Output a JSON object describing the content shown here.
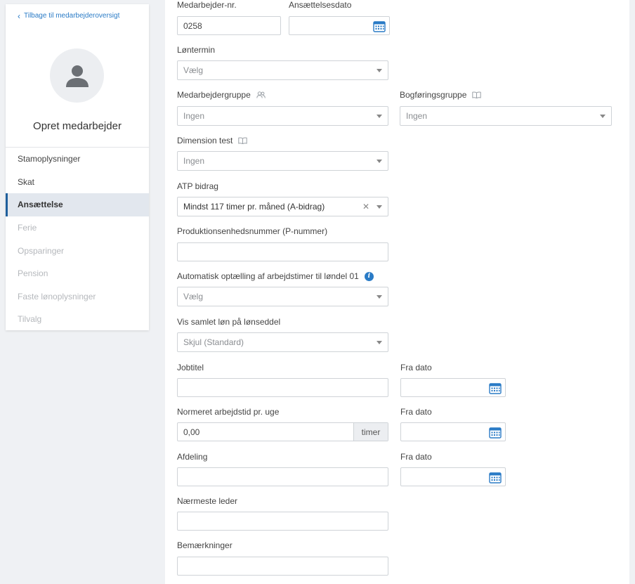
{
  "sidebar": {
    "back_label": "Tilbage til medarbejderoversigt",
    "title": "Opret medarbejder",
    "items": [
      {
        "label": "Stamoplysninger",
        "state": "normal"
      },
      {
        "label": "Skat",
        "state": "normal"
      },
      {
        "label": "Ansættelse",
        "state": "active"
      },
      {
        "label": "Ferie",
        "state": "disabled"
      },
      {
        "label": "Opsparinger",
        "state": "disabled"
      },
      {
        "label": "Pension",
        "state": "disabled"
      },
      {
        "label": "Faste lønoplysninger",
        "state": "disabled"
      },
      {
        "label": "Tilvalg",
        "state": "disabled"
      }
    ]
  },
  "form": {
    "employee_no": {
      "label": "Medarbejder-nr.",
      "value": "0258"
    },
    "employment_date": {
      "label": "Ansættelsesdato",
      "value": ""
    },
    "pay_period": {
      "label": "Løntermin",
      "value": "Vælg"
    },
    "employee_group": {
      "label": "Medarbejdergruppe",
      "value": "Ingen"
    },
    "accounting_group": {
      "label": "Bogføringsgruppe",
      "value": "Ingen"
    },
    "dimension_test": {
      "label": "Dimension test",
      "value": "Ingen"
    },
    "atp": {
      "label": "ATP bidrag",
      "value": "Mindst 117 timer pr. måned (A-bidrag)"
    },
    "p_number": {
      "label": "Produktionsenhedsnummer (P-nummer)",
      "value": ""
    },
    "auto_count": {
      "label": "Automatisk optælling af arbejdstimer til løndel 01",
      "value": "Vælg"
    },
    "total_pay": {
      "label": "Vis samlet løn på lønseddel",
      "value": "Skjul (Standard)"
    },
    "job_title": {
      "label": "Jobtitel",
      "value": ""
    },
    "job_title_from": {
      "label": "Fra dato",
      "value": ""
    },
    "weekly_hours": {
      "label": "Normeret arbejdstid pr. uge",
      "value": "0,00",
      "suffix": "timer"
    },
    "weekly_hours_from": {
      "label": "Fra dato",
      "value": ""
    },
    "department": {
      "label": "Afdeling",
      "value": ""
    },
    "department_from": {
      "label": "Fra dato",
      "value": ""
    },
    "manager": {
      "label": "Nærmeste leder",
      "value": ""
    },
    "notes": {
      "label": "Bemærkninger",
      "value": ""
    }
  },
  "colors": {
    "accent": "#2a7bc6",
    "active_nav_bg": "#e2e7ee",
    "page_bg": "#eff1f4"
  }
}
